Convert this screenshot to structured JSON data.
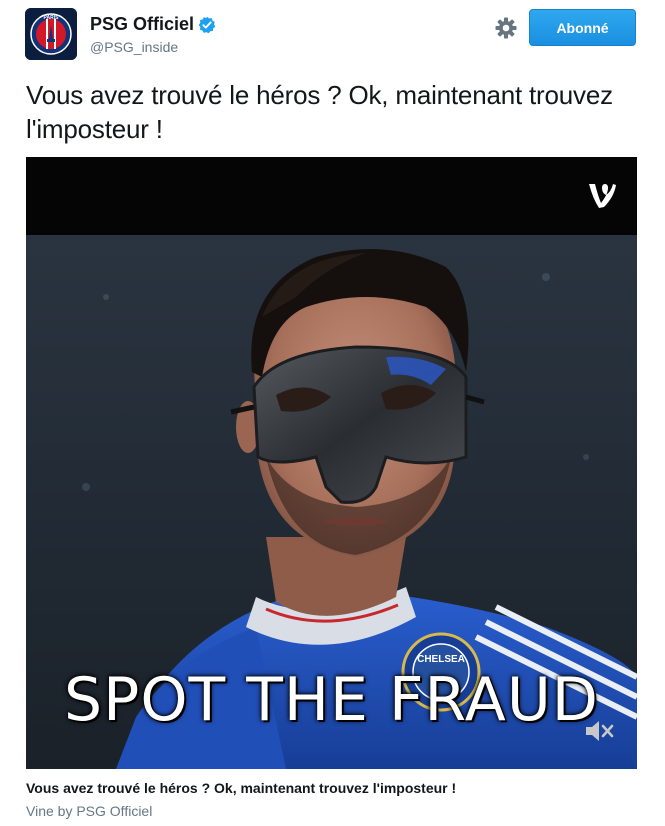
{
  "header": {
    "display_name": "PSG Officiel",
    "handle": "@PSG_inside",
    "avatar_text": "PARIS",
    "follow_label": "Abonné"
  },
  "tweet": {
    "text": "Vous avez trouvé le héros ? Ok, maintenant trouvez l'imposteur !"
  },
  "media": {
    "overlay_caption": "SPOT THE FRAUD",
    "jersey_text": "CHELSEA",
    "vine_icon": "vine-icon",
    "mute_icon": "speaker-muted-icon"
  },
  "card": {
    "title": "Vous avez trouvé le héros ? Ok, maintenant trouvez l'imposteur !",
    "source": "Vine by PSG Officiel"
  },
  "colors": {
    "follow_button": "#1da1f2",
    "verified_badge": "#1da1f2",
    "handle_text": "#657786",
    "jersey_blue": "#1f4fb5"
  }
}
